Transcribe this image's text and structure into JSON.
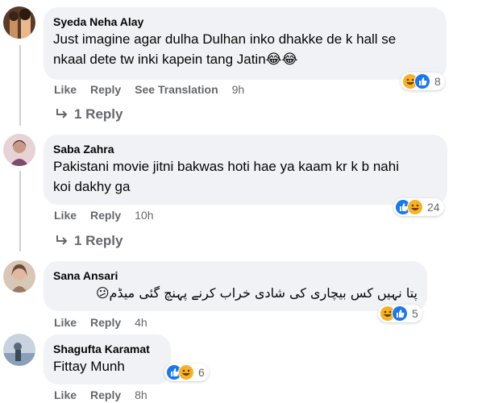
{
  "colors": {
    "bubble": "#f0f2f5",
    "muted": "#65676b",
    "like_blue": "#1877f2",
    "haha_yellow": "#f7b125"
  },
  "comments": [
    {
      "author": "Syeda Neha Alay",
      "text_lines": [
        "Just imagine agar dulha Dulhan inko dhakke de k hall se",
        "nkaal dete tw inki kapein tang Jatin😂😂"
      ],
      "like_label": "Like",
      "reply_label": "Reply",
      "translate_label": "See Translation",
      "time": "9h",
      "reaction_count": "8",
      "replies_label": "1 Reply"
    },
    {
      "author": "Saba Zahra",
      "text_lines": [
        "Pakistani movie jitni bakwas hoti hae ya kaam kr k b nahi",
        "koi dakhy ga"
      ],
      "like_label": "Like",
      "reply_label": "Reply",
      "time": "10h",
      "reaction_count": "24",
      "replies_label": "1 Reply"
    },
    {
      "author": "Sana Ansari",
      "text_lines": [
        "پتا نہیں کس بیچاری کی شادی خراب کرنے پہنچ گئی میڈم😕"
      ],
      "like_label": "Like",
      "reply_label": "Reply",
      "time": "4h",
      "reaction_count": "5"
    },
    {
      "author": "Shagufta Karamat",
      "text_lines": [
        "Fittay Munh"
      ],
      "like_label": "Like",
      "reply_label": "Reply",
      "time": "8h",
      "reaction_count": "6"
    }
  ]
}
